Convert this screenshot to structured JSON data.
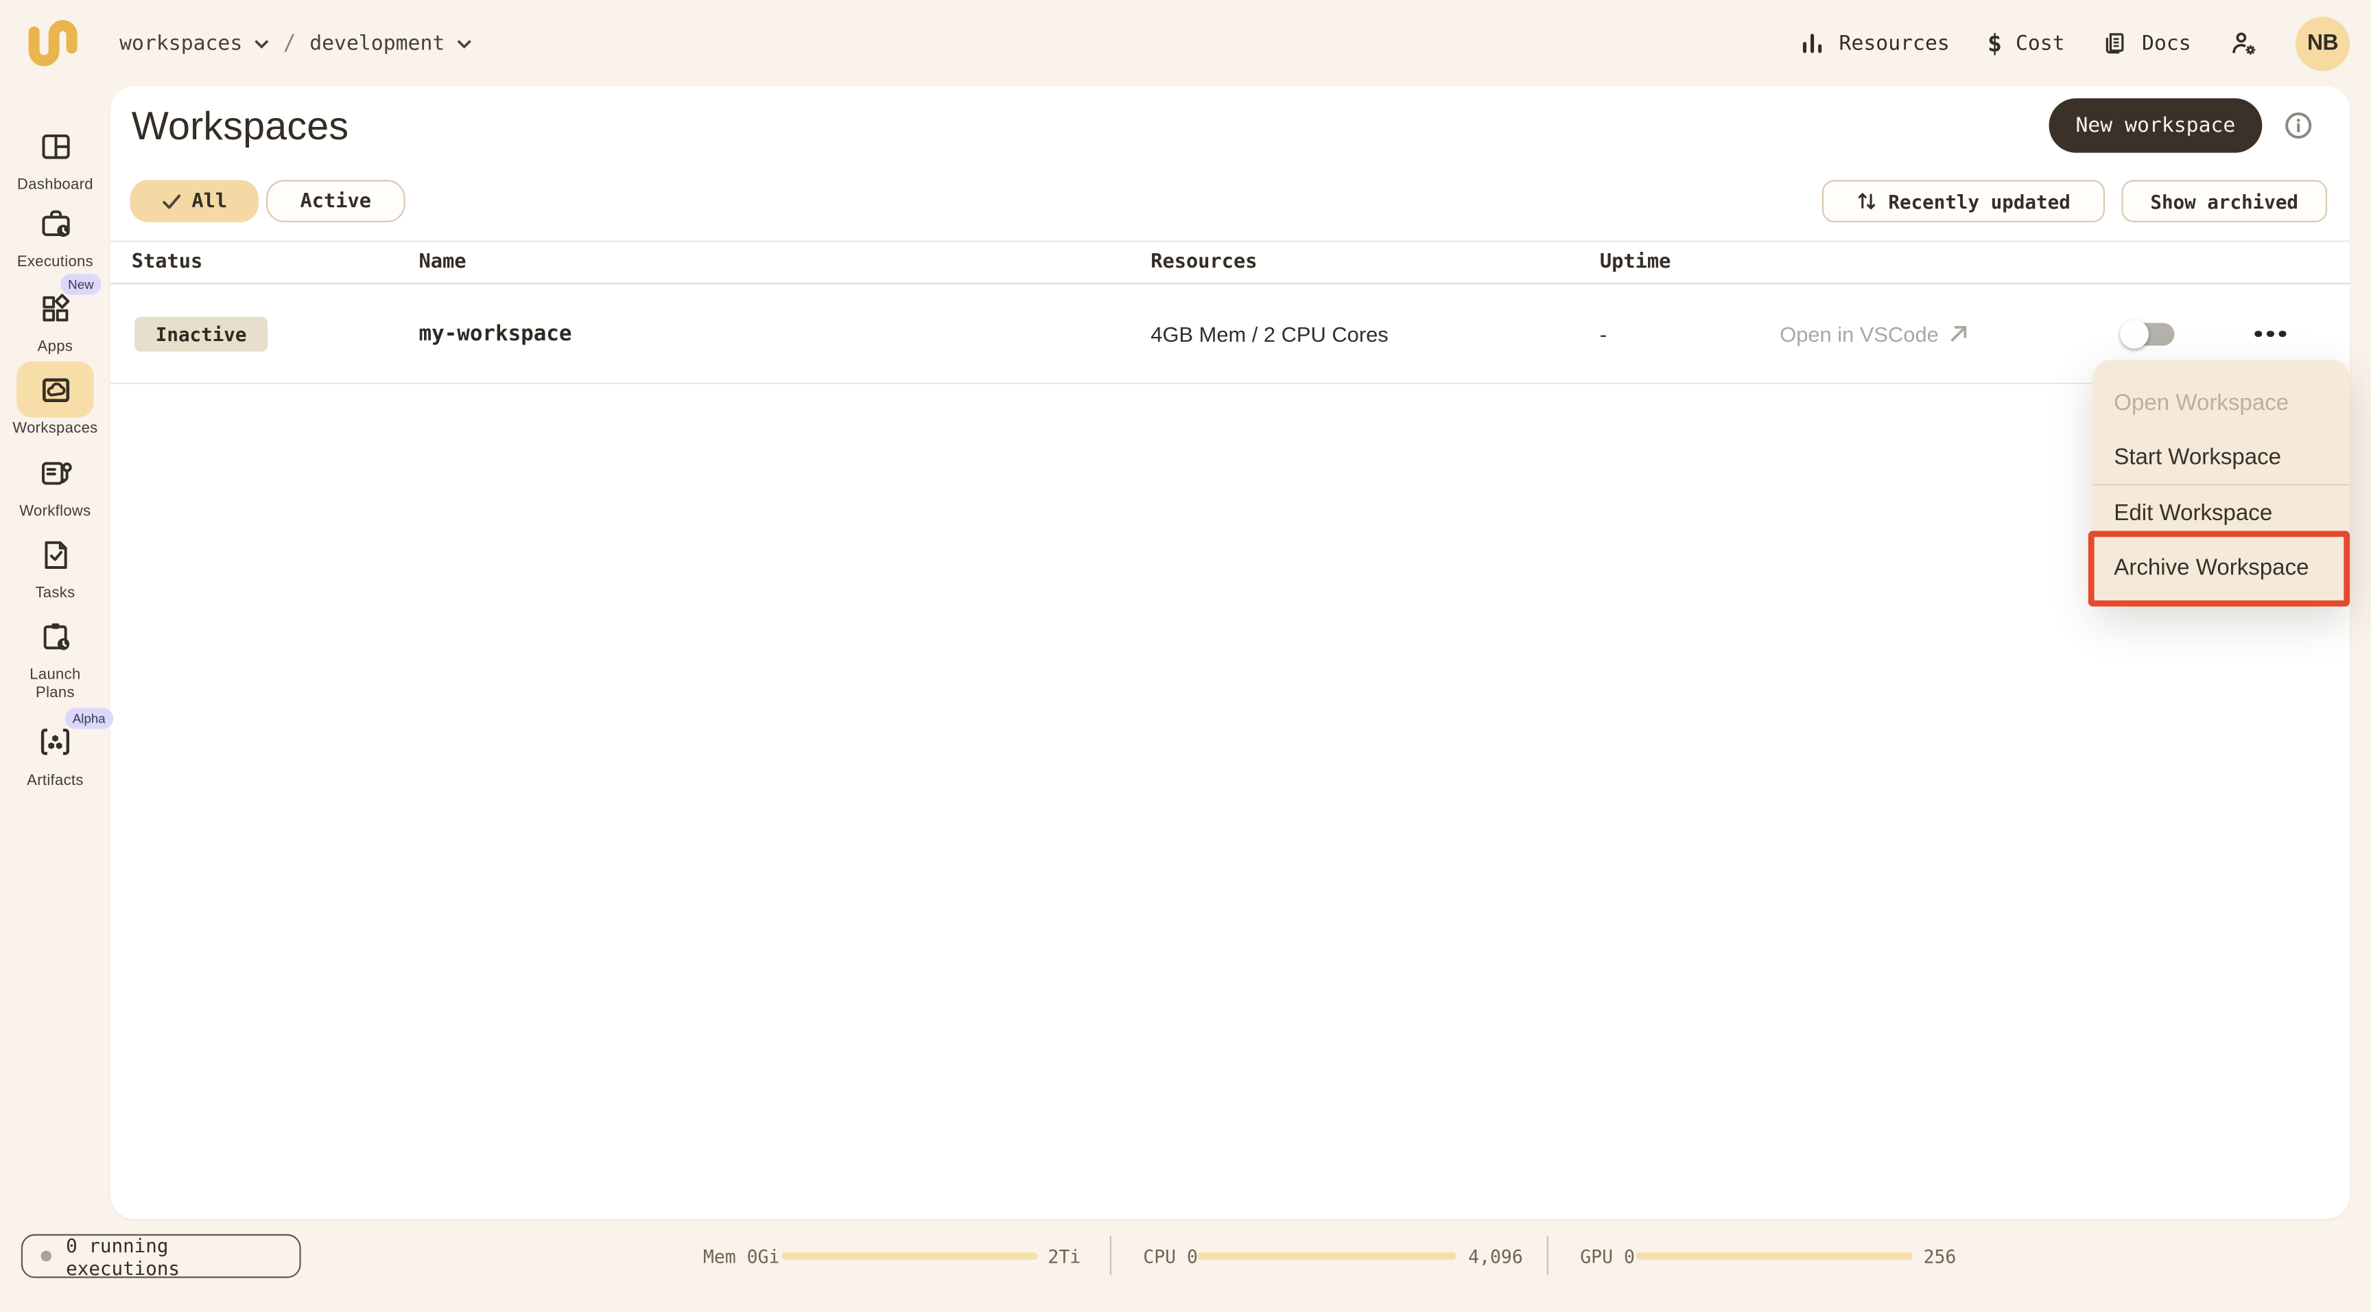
{
  "topbar": {
    "breadcrumb": {
      "project": "workspaces",
      "separator": "/",
      "domain": "development"
    },
    "nav": [
      {
        "label": "Resources",
        "icon": "bar-chart-icon"
      },
      {
        "label": "Cost",
        "icon": "dollar-icon",
        "dollar_glyph": "$"
      },
      {
        "label": "Docs",
        "icon": "docs-icon"
      }
    ],
    "avatar_initials": "NB"
  },
  "sidebar": {
    "items": [
      {
        "label": "Dashboard",
        "icon": "dashboard-icon",
        "active": false,
        "badge": ""
      },
      {
        "label": "Executions",
        "icon": "executions-icon",
        "active": false,
        "badge": ""
      },
      {
        "label": "Apps",
        "icon": "apps-icon",
        "active": false,
        "badge": "New"
      },
      {
        "label": "Workspaces",
        "icon": "workspaces-icon",
        "active": true,
        "badge": ""
      },
      {
        "label": "Workflows",
        "icon": "workflows-icon",
        "active": false,
        "badge": ""
      },
      {
        "label": "Tasks",
        "icon": "tasks-icon",
        "active": false,
        "badge": ""
      },
      {
        "label": "Launch Plans",
        "icon": "launch-plans-icon",
        "active": false,
        "badge": ""
      },
      {
        "label": "Artifacts",
        "icon": "artifacts-icon",
        "active": false,
        "badge": "Alpha"
      }
    ]
  },
  "page": {
    "title": "Workspaces",
    "new_workspace_button": "New workspace",
    "filters": {
      "all": "All",
      "active": "Active"
    },
    "sort_button": "Recently updated",
    "archived_button": "Show archived"
  },
  "table": {
    "headers": [
      "Status",
      "Name",
      "Resources",
      "Uptime"
    ],
    "rows": [
      {
        "status": "Inactive",
        "name": "my-workspace",
        "resources": "4GB Mem / 2 CPU Cores",
        "uptime": "-",
        "open_link": "Open in VSCode",
        "toggle_state": "off"
      }
    ]
  },
  "menu": {
    "items": [
      {
        "label": "Open Workspace",
        "disabled": true,
        "highlighted": false
      },
      {
        "label": "Start Workspace",
        "disabled": false,
        "highlighted": false
      },
      {
        "label": "Edit Workspace",
        "disabled": false,
        "highlighted": false
      },
      {
        "label": "Archive Workspace",
        "disabled": false,
        "highlighted": true
      }
    ]
  },
  "statusbar": {
    "running_executions": "0 running executions",
    "meters": [
      {
        "label": "Mem 0Gi",
        "max": "2Ti"
      },
      {
        "label": "CPU 0",
        "max": "4,096"
      },
      {
        "label": "GPU 0",
        "max": "256"
      }
    ]
  },
  "colors": {
    "background_cream": "#FAF3EC",
    "card_white": "#FFFFFF",
    "brand_orange": "#EAB54E",
    "dark_brown": "#3A3129",
    "active_pill_tan": "#F7DDA7",
    "chip_tan": "#F5D9A4",
    "avatar_tan": "#F7D9A2",
    "inactive_badge": "#E7DECB",
    "menu_cream": "#F5EAD9",
    "badge_lavender": "#DCD9F8",
    "highlight_red": "#E54A2F",
    "meter_bar_tan": "#F6DFAB",
    "disabled_text": "#B9AFA2",
    "toggle_track_gray": "#B4B1AB"
  }
}
